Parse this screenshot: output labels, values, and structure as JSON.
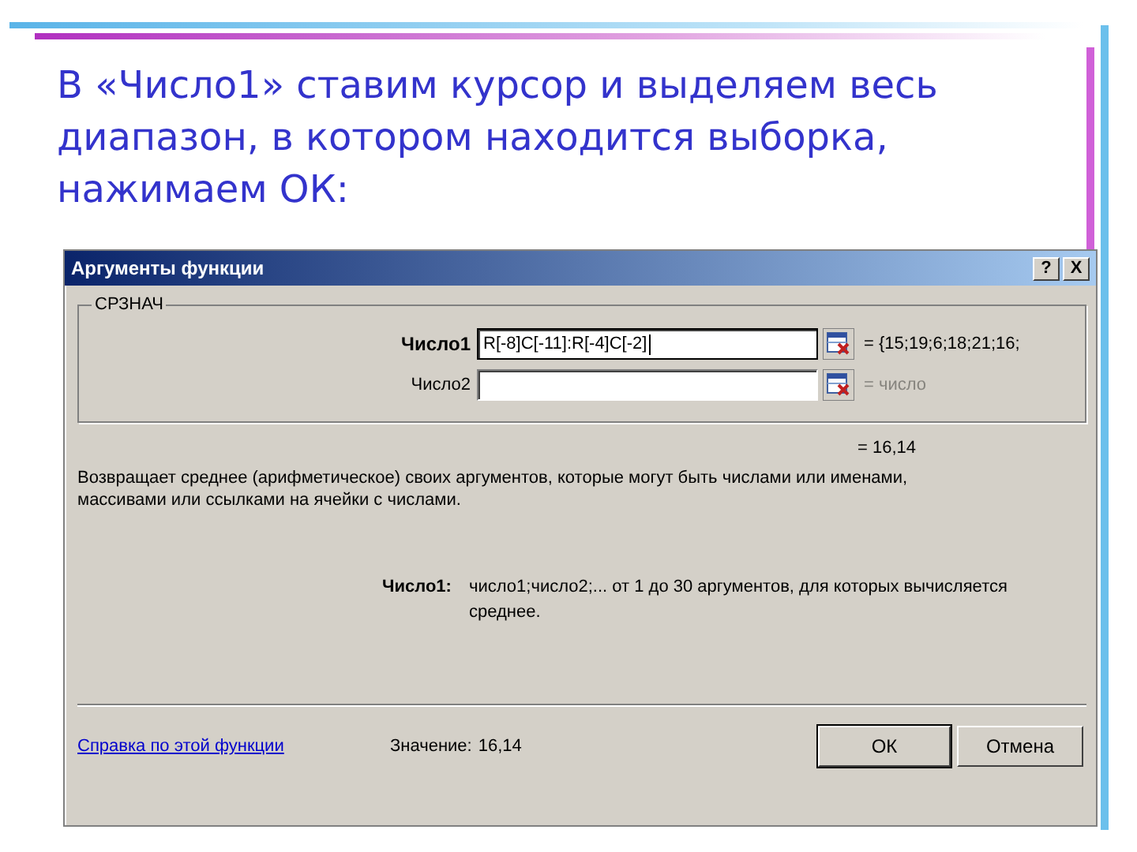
{
  "slide": {
    "title": "В «Число1» ставим курсор и выделяем весь диапазон, в котором находится выборка, нажимаем ОК:"
  },
  "dialog": {
    "title": "Аргументы функции",
    "title_buttons": [
      "?",
      "X"
    ],
    "function_name": "СРЗНАЧ",
    "arguments": [
      {
        "label": "Число1",
        "required": true,
        "value": "R[-8]C[-11]:R[-4]C[-2]",
        "focused": true,
        "result": "= {15;19;6;18;21;16;",
        "dimmed": false
      },
      {
        "label": "Число2",
        "required": false,
        "focused": false,
        "result": "= число",
        "dimmed": true
      }
    ],
    "formula_result": "= 16,14",
    "description": "Возвращает среднее (арифметическое) своих аргументов, которые могут быть числами или именами, массивами или ссылками на ячейки с числами.",
    "argument_help": {
      "label": "Число1:",
      "text": "число1;число2;... от 1 до 30 аргументов, для которых вычисляется среднее."
    },
    "help_link": "Справка по этой функции",
    "value_label": "Значение:",
    "value": "16,14",
    "buttons": [
      {
        "label": "ОК",
        "default": true
      },
      {
        "label": "Отмена",
        "default": false
      }
    ]
  }
}
